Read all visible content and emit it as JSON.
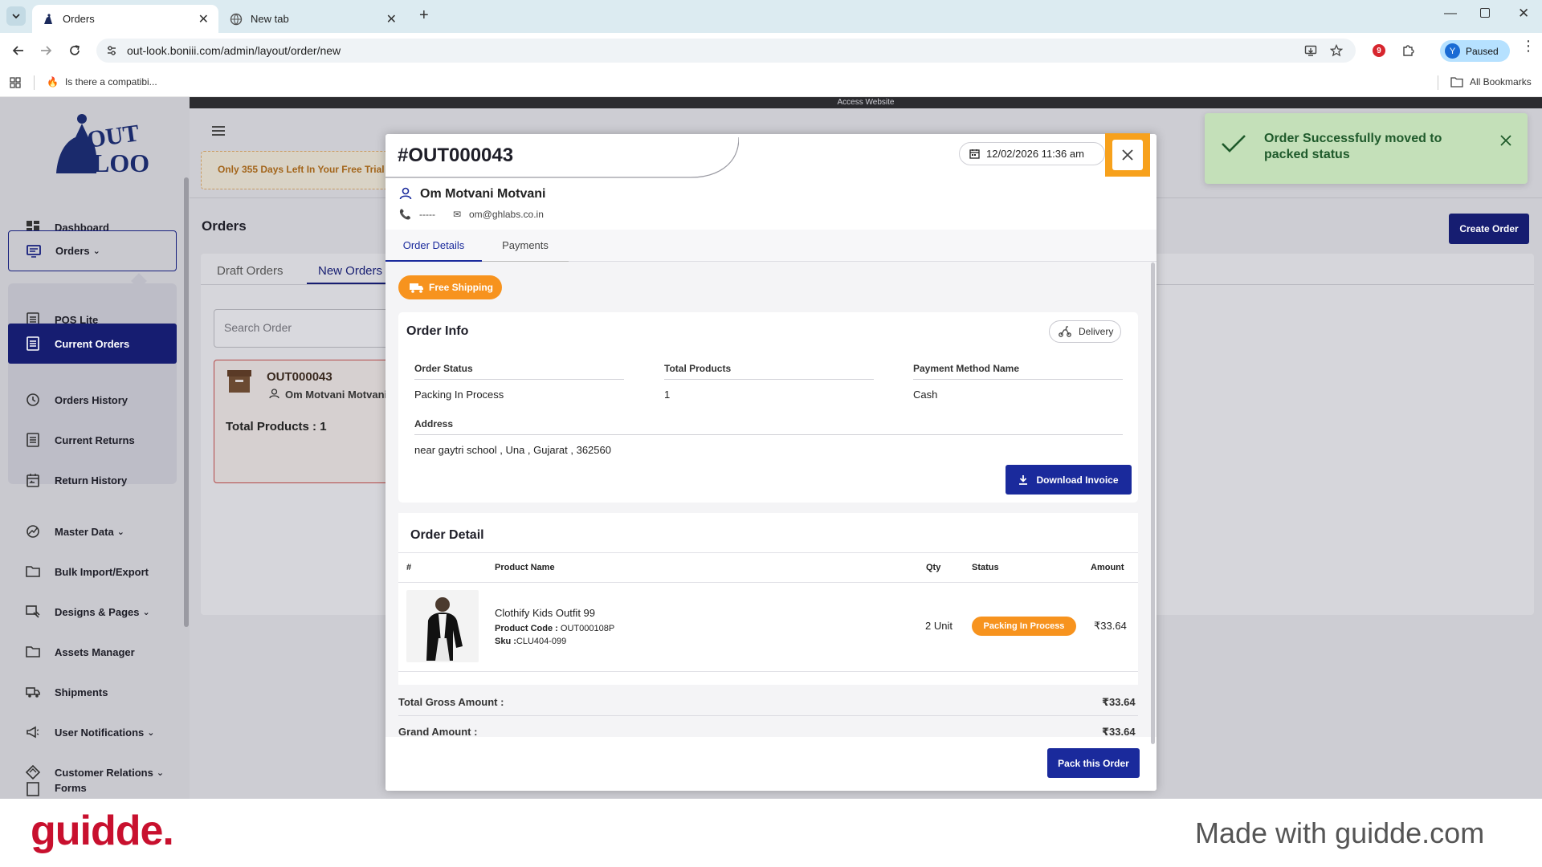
{
  "browser": {
    "tabs": [
      {
        "label": "Orders",
        "active": true
      },
      {
        "label": "New tab",
        "active": false
      }
    ],
    "url": "out-look.boniii.com/admin/layout/order/new",
    "profile_initial": "Y",
    "profile_status": "Paused",
    "extension_badge": "9",
    "bookmark": "Is there a compatibi...",
    "all_bookmarks": "All Bookmarks"
  },
  "app": {
    "access_website": "Access Website",
    "trial_notice": "Only 355 Days Left In Your Free Trial",
    "page_title": "Orders",
    "create_order": "Create Order",
    "tabs": [
      "Draft Orders",
      "New Orders"
    ],
    "search_placeholder": "Search Order",
    "order_card": {
      "id": "OUT000043",
      "customer": "Om Motvani Motvani",
      "total_products": "Total Products : 1"
    },
    "sidebar": {
      "dashboard": "Dashboard",
      "orders": "Orders",
      "pos_lite": "POS Lite",
      "current_orders": "Current Orders",
      "orders_history": "Orders History",
      "current_returns": "Current Returns",
      "return_history": "Return History",
      "master_data": "Master Data",
      "bulk_import_export": "Bulk Import/Export",
      "designs_pages": "Designs & Pages",
      "assets_manager": "Assets Manager",
      "shipments": "Shipments",
      "user_notifications": "User Notifications",
      "customer_relations": "Customer Relations",
      "forms": "Forms"
    }
  },
  "modal": {
    "order_id": "#OUT000043",
    "datetime": "12/02/2026 11:36 am",
    "customer_name": "Om Motvani Motvani",
    "phone": "-----",
    "email": "om@ghlabs.co.in",
    "tabs": [
      "Order Details",
      "Payments"
    ],
    "free_shipping": "Free Shipping",
    "order_info": {
      "title": "Order Info",
      "delivery_badge": "Delivery",
      "labels": {
        "status": "Order Status",
        "products": "Total Products",
        "payment": "Payment Method Name",
        "address": "Address"
      },
      "values": {
        "status": "Packing In Process",
        "products": "1",
        "payment": "Cash",
        "address": "near gaytri school , Una , Gujarat , 362560"
      },
      "download_invoice": "Download Invoice"
    },
    "order_detail": {
      "title": "Order Detail",
      "columns": {
        "num": "#",
        "product": "Product Name",
        "qty": "Qty",
        "status": "Status",
        "amount": "Amount"
      },
      "rows": [
        {
          "product_name": "Clothify Kids Outfit 99",
          "product_code_label": "Product Code :",
          "product_code": "OUT000108P",
          "sku_label": "Sku :",
          "sku": "CLU404-099",
          "qty": "2 Unit",
          "status": "Packing In Process",
          "amount": "₹33.64"
        }
      ]
    },
    "totals": {
      "gross_label": "Total Gross Amount :",
      "gross_value": "₹33.64",
      "grand_label": "Grand Amount :",
      "grand_value": "₹33.64"
    },
    "pack_button": "Pack this Order"
  },
  "toast": {
    "message": "Order Successfully moved to packed status"
  },
  "watermark": {
    "brand": "guidde.",
    "made_with": "Made with guidde.com"
  },
  "colors": {
    "primary": "#161d71",
    "accent_orange": "#f7a11c",
    "toast_bg": "#c4e0b9",
    "brand_red": "#c8102e"
  }
}
